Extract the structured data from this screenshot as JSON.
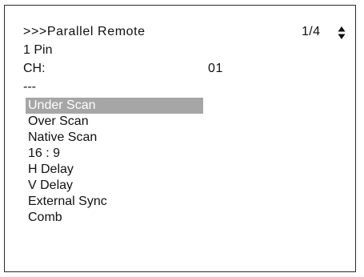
{
  "header": {
    "title": ">>>Parallel Remote",
    "page_indicator": "1/4",
    "scroll_icon": "up-down-arrows-icon"
  },
  "pin_label": "1 Pin",
  "channel": {
    "label": "CH:",
    "value": "01"
  },
  "separator": "---",
  "menu": {
    "selected_index": 0,
    "items": [
      {
        "label": "Under Scan"
      },
      {
        "label": "Over Scan"
      },
      {
        "label": "Native Scan"
      },
      {
        "label": "16 : 9"
      },
      {
        "label": "H Delay"
      },
      {
        "label": "V Delay"
      },
      {
        "label": "External Sync"
      },
      {
        "label": "Comb"
      }
    ]
  },
  "colors": {
    "selection_highlight": "#a6a6a6",
    "selection_text": "#ffffff",
    "text": "#111111",
    "border": "#2a2a2a"
  }
}
